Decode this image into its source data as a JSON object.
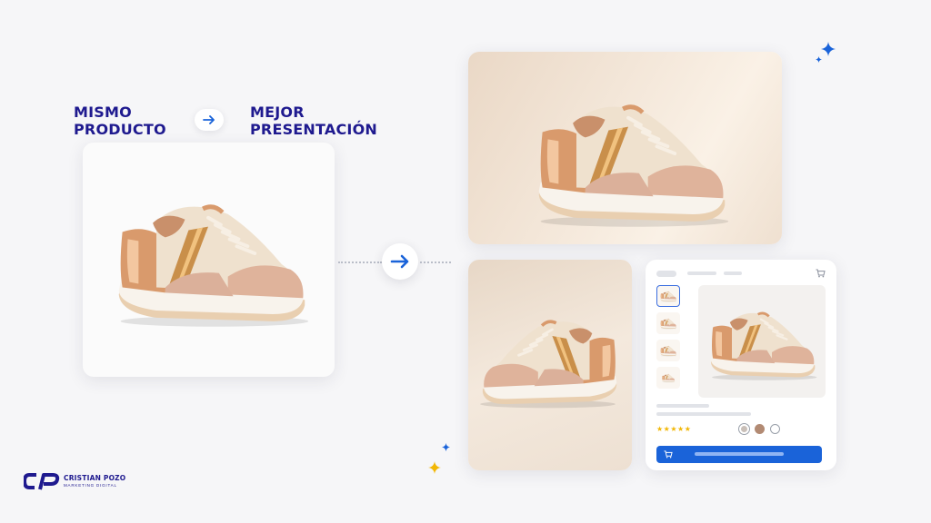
{
  "headline": {
    "left": [
      "MISMO",
      "PRODUCTO"
    ],
    "right": [
      "MEJOR",
      "PRESENTACIÓN"
    ]
  },
  "icons": {
    "small_arrow": "arrow-right-icon",
    "big_arrow": "arrow-right-icon",
    "cart": "cart-icon",
    "sparkle": "sparkle-icon"
  },
  "ecommerce_mock": {
    "rating_stars": "★★★★★",
    "swatch_colors": [
      "#c9bfb8",
      "#b28a73",
      "#ffffff"
    ]
  },
  "logo": {
    "name": "CRISTIAN POZO",
    "tagline": "MARKETING DIGITAL"
  },
  "colors": {
    "brand_navy": "#1f1a8f",
    "accent_blue": "#1a63d9",
    "background": "#f6f6f8"
  }
}
